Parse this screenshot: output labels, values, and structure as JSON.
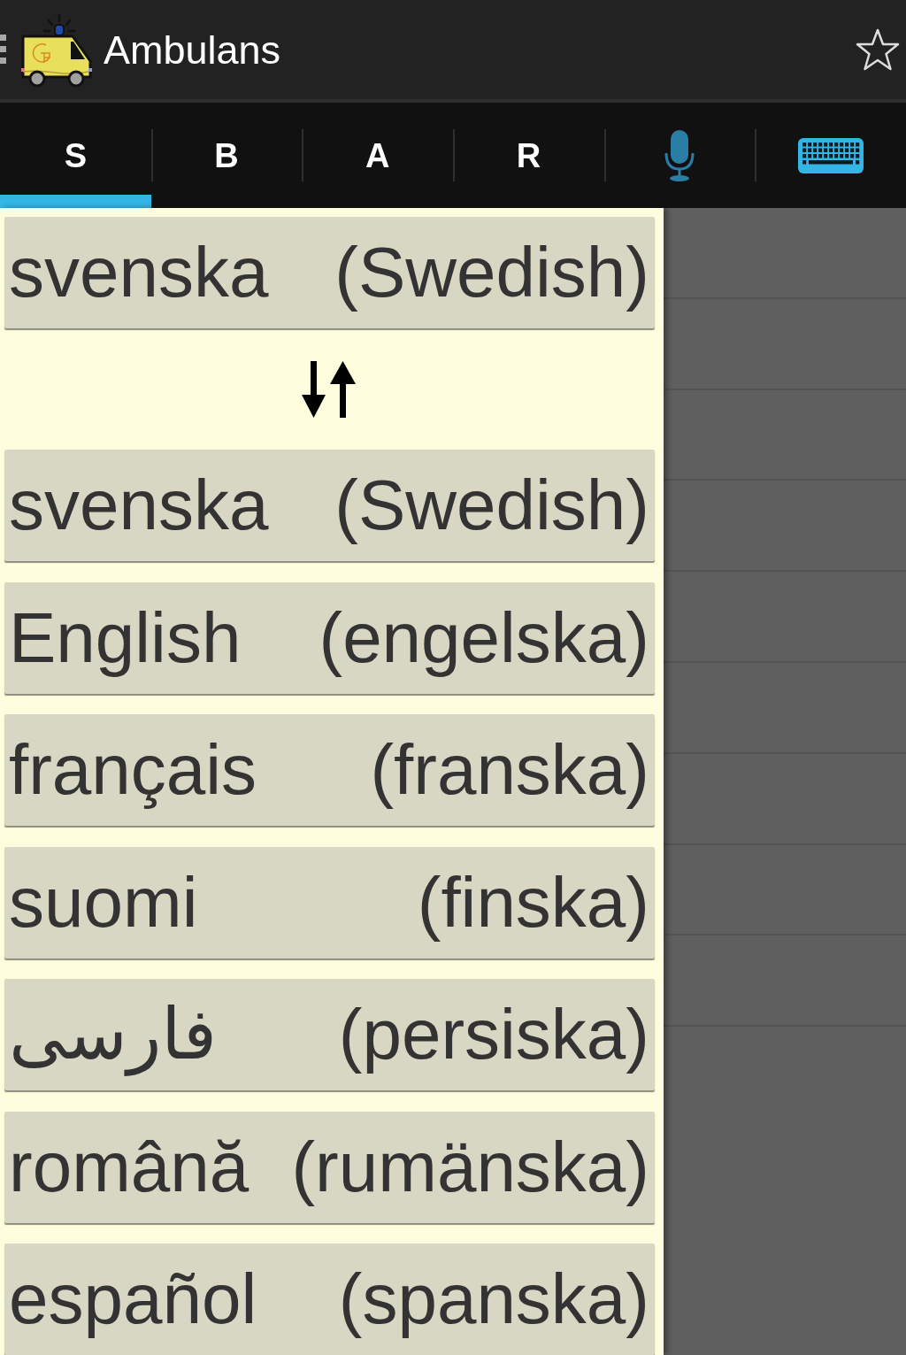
{
  "action_bar": {
    "title": "Ambulans",
    "starred": false
  },
  "tabs": [
    {
      "kind": "letter",
      "label": "S",
      "selected": true
    },
    {
      "kind": "letter",
      "label": "B",
      "selected": false
    },
    {
      "kind": "letter",
      "label": "A",
      "selected": false
    },
    {
      "kind": "letter",
      "label": "R",
      "selected": false
    },
    {
      "kind": "microphone",
      "selected": false
    },
    {
      "kind": "keyboard",
      "selected": false
    }
  ],
  "language_picker": {
    "current": {
      "name": "svenska",
      "translation": "(Swedish)"
    },
    "languages": [
      {
        "name": "svenska",
        "translation": "(Swedish)"
      },
      {
        "name": "English",
        "translation": "(engelska)"
      },
      {
        "name": "français",
        "translation": "(franska)"
      },
      {
        "name": "suomi",
        "translation": "(finska)"
      },
      {
        "name": "فارسی",
        "translation": "(persiska)"
      },
      {
        "name": "română",
        "translation": "(rumänska)"
      },
      {
        "name": "español",
        "translation": "(spanska)"
      }
    ]
  }
}
